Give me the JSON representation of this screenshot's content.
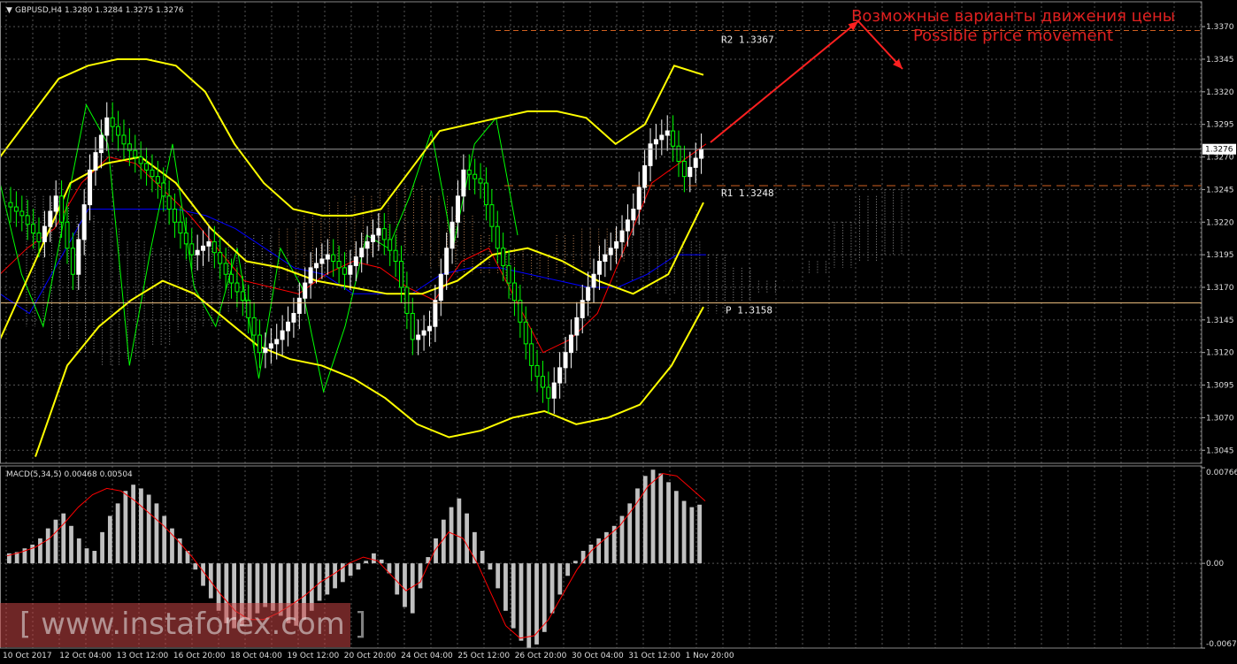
{
  "window": {
    "symbol_header": "GBPUSD,H4  1.3280 1.3284 1.3275 1.3276",
    "macd_header": "MACD(5,34,5) 0.00468 0.00504"
  },
  "annotation": {
    "ru": "Возможные варианты движения цены",
    "en": "Possible price movement"
  },
  "watermark": "[ www.instaforex.com ]",
  "colors": {
    "background": "#000000",
    "bull_candle": "#ffffff",
    "bear_candle": "#00ff00",
    "bollinger": "#ffff00",
    "tenkan": "#ff0000",
    "kijun": "#0000ff",
    "chikou": "#00ff00",
    "kumo_up": "#ffb070",
    "kumo_down": "#d0d0d0",
    "macd_hist": "#c0c0c0",
    "macd_signal": "#ff0000",
    "arrow": "#ff2020",
    "grid": "#555555"
  },
  "chart_data": [
    {
      "type": "candlestick",
      "title": "GBPUSD,H4",
      "ohlc_last": {
        "open": 1.328,
        "high": 1.3284,
        "low": 1.3275,
        "close": 1.3276
      },
      "current_price": 1.3276,
      "ylim": [
        1.3035,
        1.3385
      ],
      "y_ticks": [
        1.337,
        1.3345,
        1.332,
        1.3295,
        1.327,
        1.3245,
        1.322,
        1.3195,
        1.317,
        1.3145,
        1.312,
        1.3095,
        1.307,
        1.3045
      ],
      "x_ticks": [
        "10 Oct 2017",
        "12 Oct 04:00",
        "13 Oct 12:00",
        "16 Oct 20:00",
        "18 Oct 04:00",
        "19 Oct 12:00",
        "20 Oct 20:00",
        "24 Oct 04:00",
        "25 Oct 12:00",
        "26 Oct 20:00",
        "30 Oct 04:00",
        "31 Oct 12:00",
        "1 Nov 20:00"
      ],
      "levels": [
        {
          "name": "R2",
          "label": "R2  1.3367",
          "value": 1.3367
        },
        {
          "name": "R1",
          "label": "R1  1.3248",
          "value": 1.3248
        },
        {
          "name": "P",
          "label": "P  1.3158",
          "value": 1.3158
        }
      ],
      "close_series": [
        1.3225,
        1.3205,
        1.324,
        1.318,
        1.326,
        1.33,
        1.328,
        1.3265,
        1.325,
        1.322,
        1.3195,
        1.3205,
        1.318,
        1.316,
        1.312,
        1.313,
        1.315,
        1.3185,
        1.3195,
        1.318,
        1.32,
        1.3215,
        1.319,
        1.313,
        1.314,
        1.32,
        1.326,
        1.325,
        1.32,
        1.316,
        1.311,
        1.3085,
        1.312,
        1.316,
        1.319,
        1.3205,
        1.323,
        1.328,
        1.329,
        1.3255,
        1.3276
      ],
      "bollinger_upper": [
        1.327,
        1.33,
        1.333,
        1.334,
        1.3345,
        1.3345,
        1.334,
        1.332,
        1.328,
        1.325,
        1.323,
        1.3225,
        1.3225,
        1.323,
        1.326,
        1.329,
        1.3295,
        1.33,
        1.3305,
        1.3305,
        1.33,
        1.328,
        1.3295,
        1.334,
        1.3333
      ],
      "bollinger_lower": [
        1.304,
        1.311,
        1.314,
        1.316,
        1.3175,
        1.3165,
        1.3145,
        1.3125,
        1.3115,
        1.311,
        1.31,
        1.3085,
        1.3065,
        1.3055,
        1.306,
        1.307,
        1.3075,
        1.3065,
        1.307,
        1.308,
        1.311,
        1.3155
      ],
      "bollinger_mid": [
        1.313,
        1.319,
        1.325,
        1.3265,
        1.327,
        1.325,
        1.3215,
        1.319,
        1.3185,
        1.3175,
        1.317,
        1.3165,
        1.3165,
        1.3175,
        1.3195,
        1.32,
        1.319,
        1.3175,
        1.3165,
        1.318,
        1.3235
      ]
    },
    {
      "type": "bar",
      "title": "MACD(5,34,5)",
      "main": 0.00468,
      "signal": 0.00504,
      "ylim": [
        -0.00679,
        0.00766
      ],
      "y_ticks": [
        0.00766,
        0.0,
        -0.00679
      ],
      "y_tick_labels": [
        "0.00766",
        "0.00",
        "-0.00679"
      ],
      "histogram": [
        0.0008,
        0.0009,
        0.0012,
        0.0015,
        0.002,
        0.0028,
        0.0035,
        0.004,
        0.003,
        0.002,
        0.0012,
        0.001,
        0.0025,
        0.0038,
        0.0048,
        0.0058,
        0.0063,
        0.006,
        0.0055,
        0.0048,
        0.0038,
        0.0028,
        0.002,
        0.001,
        -0.0005,
        -0.0018,
        -0.0028,
        -0.0038,
        -0.0048,
        -0.0052,
        -0.005,
        -0.0045,
        -0.004,
        -0.0035,
        -0.0038,
        -0.0042,
        -0.0048,
        -0.005,
        -0.0045,
        -0.0038,
        -0.003,
        -0.0025,
        -0.002,
        -0.0015,
        -0.001,
        -0.0005,
        0.0002,
        0.0008,
        0.0003,
        -0.0008,
        -0.0025,
        -0.0035,
        -0.004,
        -0.002,
        0.0005,
        0.002,
        0.0035,
        0.0045,
        0.0052,
        0.004,
        0.0025,
        0.001,
        -0.0005,
        -0.002,
        -0.0038,
        -0.0052,
        -0.0062,
        -0.0068,
        -0.0065,
        -0.0055,
        -0.004,
        -0.0025,
        -0.001,
        0.0002,
        0.001,
        0.0015,
        0.002,
        0.0025,
        0.003,
        0.0038,
        0.0048,
        0.006,
        0.007,
        0.0075,
        0.0072,
        0.0065,
        0.0058,
        0.005,
        0.0045,
        0.0047
      ],
      "signal_line": [
        0.0006,
        0.0009,
        0.0013,
        0.002,
        0.0032,
        0.0045,
        0.0055,
        0.006,
        0.0058,
        0.005,
        0.004,
        0.003,
        0.0018,
        0.0005,
        -0.001,
        -0.0025,
        -0.0038,
        -0.0045,
        -0.0045,
        -0.004,
        -0.0033,
        -0.0025,
        -0.0015,
        -0.0008,
        0.0,
        0.0005,
        0.0002,
        -0.001,
        -0.0022,
        -0.0015,
        0.001,
        0.0025,
        0.002,
        0.0,
        -0.0025,
        -0.005,
        -0.006,
        -0.0058,
        -0.0045,
        -0.0025,
        -0.0005,
        0.001,
        0.002,
        0.003,
        0.0045,
        0.0062,
        0.0072,
        0.007,
        0.006,
        0.005
      ]
    }
  ]
}
